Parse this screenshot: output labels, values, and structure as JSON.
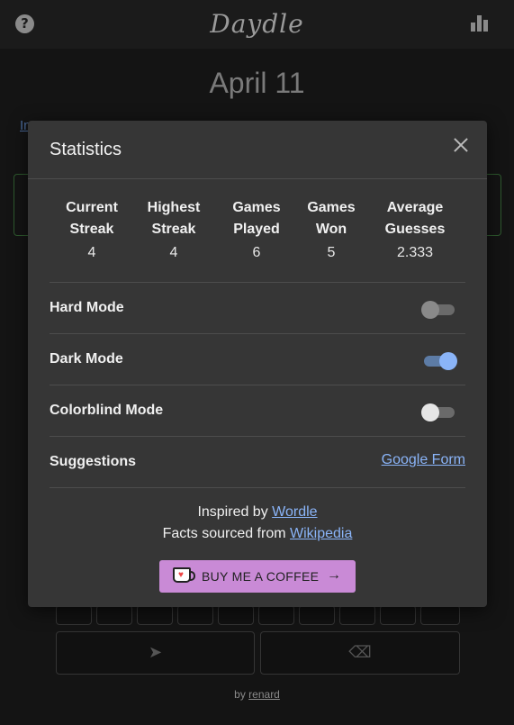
{
  "header": {
    "logo": "Daydle",
    "help_icon": "question-circle-icon",
    "stats_icon": "bar-chart-icon"
  },
  "page": {
    "date": "April 11"
  },
  "footer": {
    "by": "by",
    "author": "renard"
  },
  "modal": {
    "title": "Statistics",
    "close_icon": "close-icon",
    "stats": [
      {
        "label_line1": "Current",
        "label_line2": "Streak",
        "value": "4"
      },
      {
        "label_line1": "Highest",
        "label_line2": "Streak",
        "value": "4"
      },
      {
        "label_line1": "Games",
        "label_line2": "Played",
        "value": "6"
      },
      {
        "label_line1": "Games",
        "label_line2": "Won",
        "value": "5"
      },
      {
        "label_line1": "Average",
        "label_line2": "Guesses",
        "value": "2.333"
      }
    ],
    "settings": {
      "hard_mode": {
        "label": "Hard Mode",
        "enabled": false
      },
      "dark_mode": {
        "label": "Dark Mode",
        "enabled": true
      },
      "colorblind_mode": {
        "label": "Colorblind Mode",
        "enabled": false
      }
    },
    "suggestions": {
      "label": "Suggestions",
      "link": "Google Form"
    },
    "credits": {
      "inspired_prefix": "Inspired by",
      "inspired_link": "Wordle",
      "facts_prefix": "Facts sourced from",
      "facts_link": "Wikipedia"
    },
    "coffee_button": {
      "label": "BUY ME A COFFEE",
      "arrow": "→",
      "icon": "coffee-cup-icon"
    }
  },
  "colors": {
    "modal_bg": "#363636",
    "link": "#8ab4f8",
    "coffee": "#c98ad6",
    "toggle_on": "#8ab4f8"
  }
}
